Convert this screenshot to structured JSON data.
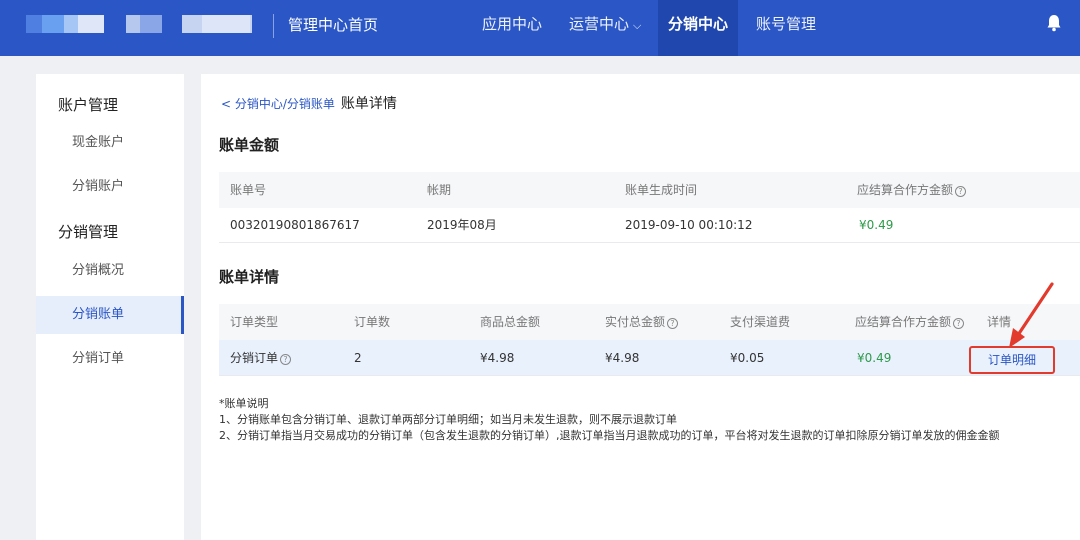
{
  "header": {
    "home_title": "管理中心首页",
    "nav": [
      {
        "label": "应用中心"
      },
      {
        "label": "运营中心"
      },
      {
        "label": "分销中心"
      },
      {
        "label": "账号管理"
      }
    ],
    "active_nav": "分销中心",
    "bg_color": "#2a56c6"
  },
  "sidebar": {
    "group1": "账户管理",
    "group2": "分销管理",
    "items": [
      {
        "label": "现金账户"
      },
      {
        "label": "分销账户"
      },
      {
        "label": "分销概况"
      },
      {
        "label": "分销账单"
      },
      {
        "label": "分销订单"
      }
    ],
    "active_item": "分销账单"
  },
  "breadcrumb": {
    "back": "分销中心/分销账单",
    "current": "账单详情"
  },
  "bill_amount": {
    "title": "账单金额",
    "headers": [
      "账单号",
      "帐期",
      "账单生成时间",
      "应结算合作方金额"
    ],
    "row": [
      "00320190801867617",
      "2019年08月",
      "2019-09-10 00:10:12",
      "¥0.49"
    ]
  },
  "bill_detail": {
    "title": "账单详情",
    "headers": [
      "订单类型",
      "订单数",
      "商品总金额",
      "实付总金额",
      "支付渠道费",
      "应结算合作方金额",
      "详情"
    ],
    "row": [
      "分销订单",
      "2",
      "¥4.98",
      "¥4.98",
      "¥0.05",
      "¥0.49",
      "订单明细"
    ]
  },
  "notes": {
    "title": "*账单说明",
    "line1": "1、分销账单包含分销订单、退款订单两部分订单明细；如当月未发生退款，则不展示退款订单",
    "line2": "2、分销订单指当月交易成功的分销订单（包含发生退款的分销订单）,退款订单指当月退款成功的订单，平台将对发生退款的订单扣除原分销订单发放的佣金金额"
  },
  "colors": {
    "accent": "#2a56c6",
    "positive": "#2e9a4a",
    "annotation": "#e23a2d"
  }
}
